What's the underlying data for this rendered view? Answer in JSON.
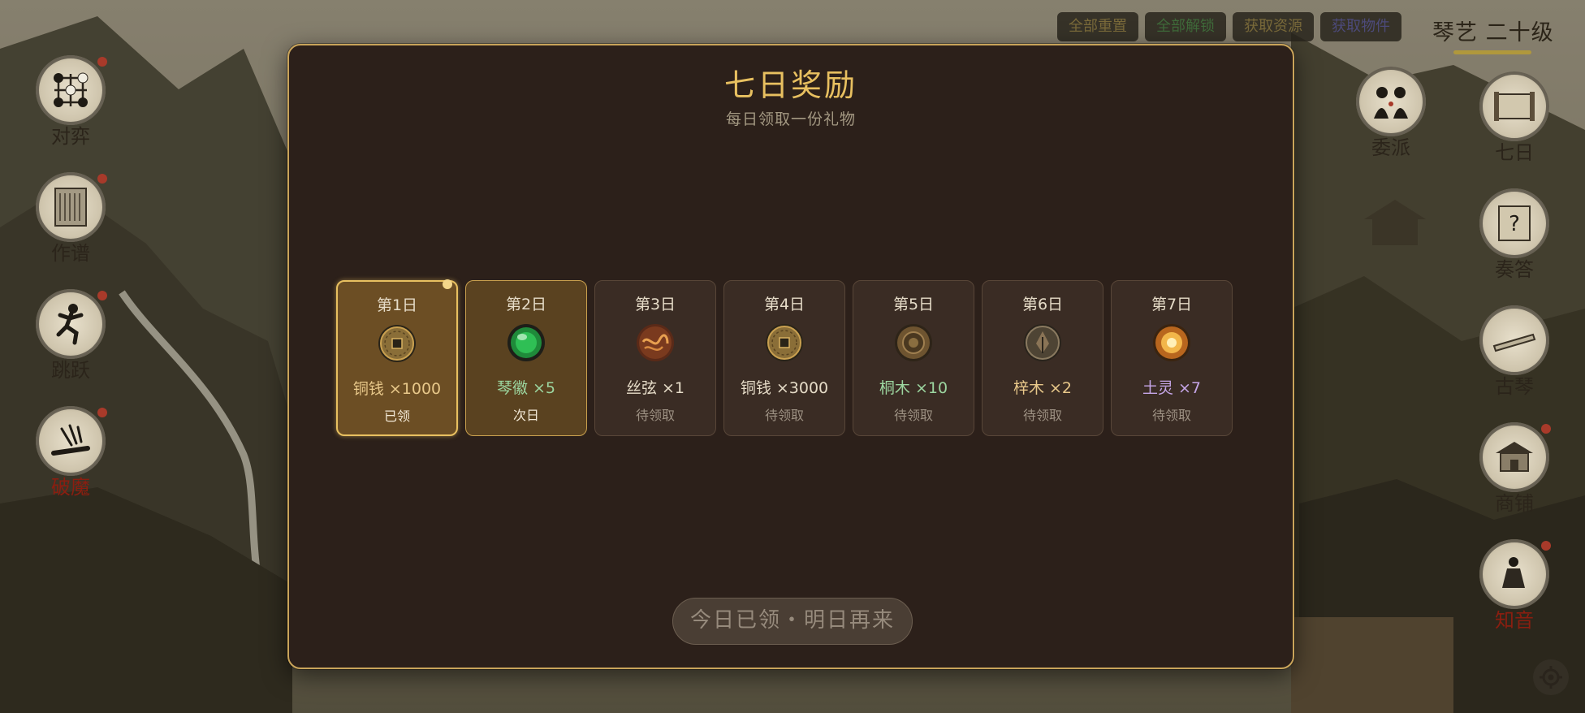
{
  "toolbar": {
    "reset_all": "全部重置",
    "unlock_all": "全部解锁",
    "get_resources": "获取资源",
    "get_items": "获取物件",
    "colors": {
      "reset_all": "#7a6a3a",
      "unlock_all": "#3f6a3a",
      "get_resources": "#7a6a3a",
      "get_items": "#4c4a7a"
    }
  },
  "level_label": "琴艺 二十级",
  "left_menu": [
    {
      "label": "对弈",
      "icon": "go-board-icon",
      "dot": true,
      "color": "#2b241a"
    },
    {
      "label": "作谱",
      "icon": "scroll-icon",
      "dot": true,
      "color": "#2b241a"
    },
    {
      "label": "跳跃",
      "icon": "jumping-figure-icon",
      "dot": true,
      "color": "#2b241a"
    },
    {
      "label": "破魔",
      "icon": "qin-strings-icon",
      "dot": true,
      "color": "#8a1e10"
    }
  ],
  "right_menu": [
    {
      "label": "委派",
      "icon": "two-figures-icon",
      "dot": false
    },
    {
      "label": "七日",
      "icon": "scroll-gift-icon",
      "dot": false
    },
    {
      "label": "奏答",
      "icon": "question-scroll-icon",
      "dot": false
    },
    {
      "label": "古琴",
      "icon": "guqin-icon",
      "dot": false
    },
    {
      "label": "商铺",
      "icon": "shop-building-icon",
      "dot": true
    },
    {
      "label": "知音",
      "icon": "seated-figure-icon",
      "dot": true
    }
  ],
  "modal": {
    "title": "七日奖励",
    "subtitle": "每日领取一份礼物",
    "days": [
      {
        "day": "第1日",
        "reward": "铜钱 ×1000",
        "status": "已领",
        "state": "claimed",
        "icon": "copper-coin-icon",
        "reward_color": "#e8c88a"
      },
      {
        "day": "第2日",
        "reward": "琴徽 ×5",
        "status": "次日",
        "state": "next",
        "icon": "jade-orb-icon",
        "reward_color": "#9cd6a0"
      },
      {
        "day": "第3日",
        "reward": "丝弦 ×1",
        "status": "待领取",
        "state": "pending",
        "icon": "silk-string-icon",
        "reward_color": "#e6dcc8"
      },
      {
        "day": "第4日",
        "reward": "铜钱 ×3000",
        "status": "待领取",
        "state": "pending",
        "icon": "copper-coin-icon",
        "reward_color": "#e6dcc8"
      },
      {
        "day": "第5日",
        "reward": "桐木 ×10",
        "status": "待领取",
        "state": "pending",
        "icon": "tung-wood-icon",
        "reward_color": "#9cd6a0"
      },
      {
        "day": "第6日",
        "reward": "梓木 ×2",
        "status": "待领取",
        "state": "pending",
        "icon": "catalpa-wood-icon",
        "reward_color": "#e8c88a"
      },
      {
        "day": "第7日",
        "reward": "土灵 ×7",
        "status": "待领取",
        "state": "pending",
        "icon": "earth-spirit-icon",
        "reward_color": "#c6a6e8"
      }
    ],
    "claim_button": "今日已领・明日再来"
  },
  "settings_icon": "gear-icon"
}
